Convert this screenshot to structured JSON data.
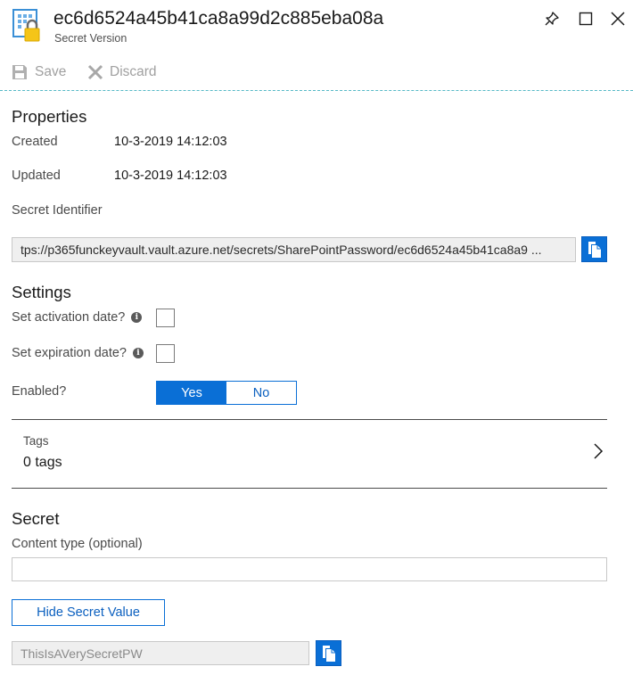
{
  "header": {
    "title": "ec6d6524a45b41ca8a99d2c885eba08a",
    "subtitle": "Secret Version"
  },
  "toolbar": {
    "save_label": "Save",
    "discard_label": "Discard"
  },
  "properties": {
    "heading": "Properties",
    "created_label": "Created",
    "created_value": "10-3-2019 14:12:03",
    "updated_label": "Updated",
    "updated_value": "10-3-2019 14:12:03",
    "identifier_label": "Secret Identifier",
    "identifier_value": "tps://p365funckeyvault.vault.azure.net/secrets/SharePointPassword/ec6d6524a45b41ca8a9 ..."
  },
  "settings": {
    "heading": "Settings",
    "activation_label": "Set activation date?",
    "expiration_label": "Set expiration date?",
    "enabled_label": "Enabled?",
    "enabled_yes": "Yes",
    "enabled_no": "No",
    "enabled_selected": "Yes"
  },
  "tags": {
    "label": "Tags",
    "value": "0 tags"
  },
  "secret": {
    "heading": "Secret",
    "content_type_label": "Content type (optional)",
    "content_type_value": "",
    "hide_button_label": "Hide Secret Value",
    "secret_value": "ThisIsAVerySecretPW"
  },
  "colors": {
    "accent": "#0a6fd6",
    "toolbar_separator": "#55b8c6",
    "disabled_text": "#a0a0a0"
  }
}
